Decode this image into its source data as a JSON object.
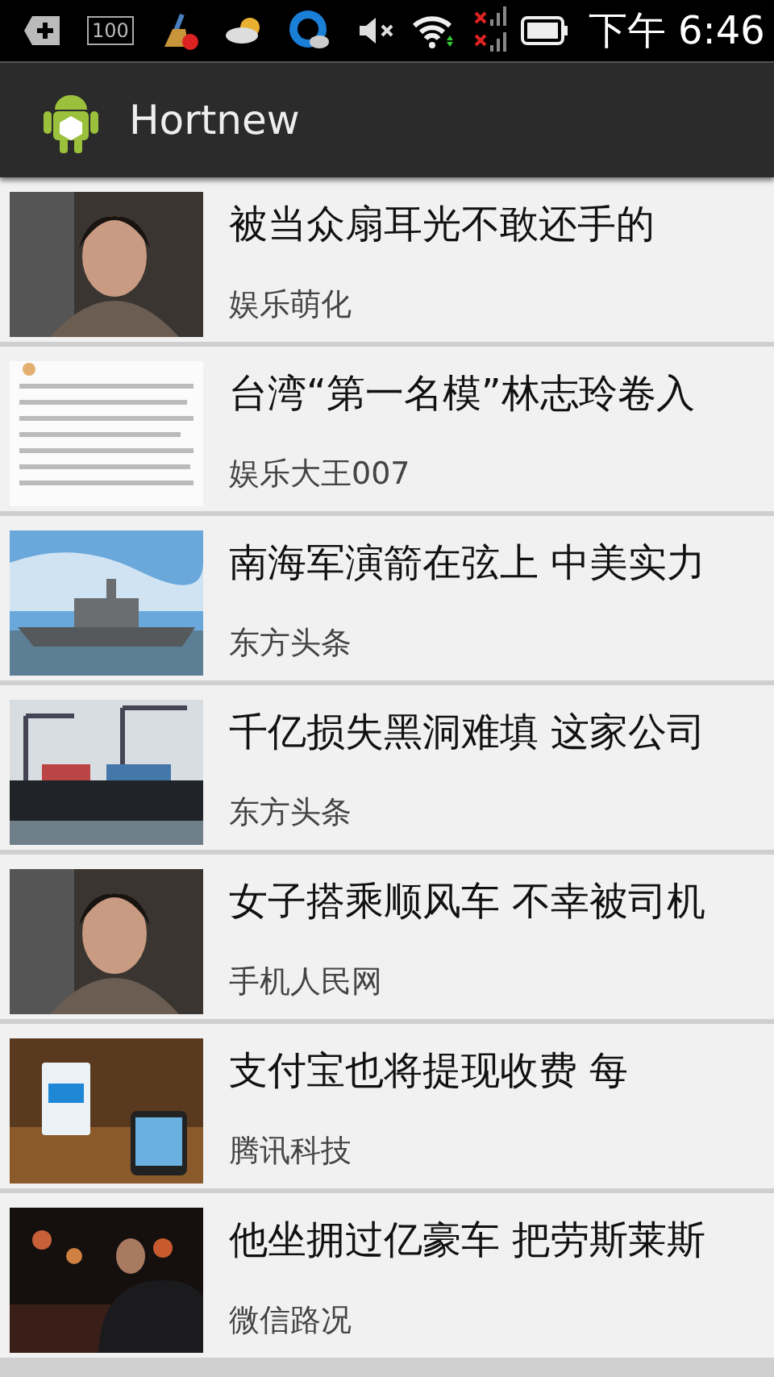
{
  "status_bar": {
    "storage_badge": "100",
    "time": "下午 6:46"
  },
  "action_bar": {
    "title": "Hortnew"
  },
  "news": [
    {
      "kind": "picture",
      "title": "被当众扇耳光不敢还手的",
      "source": "娱乐萌化"
    },
    {
      "kind": "picture",
      "title": "台湾“第一名模”林志玲卷入",
      "source": "娱乐大王007"
    },
    {
      "kind": "picture",
      "title": "南海军演箭在弦上 中美实力",
      "source": "东方头条"
    },
    {
      "kind": "picture",
      "title": "千亿损失黑洞难填 这家公司",
      "source": "东方头条"
    },
    {
      "kind": "picture",
      "title": "女子搭乘顺风车 不幸被司机",
      "source": "手机人民网"
    },
    {
      "kind": "picture",
      "title": "支付宝也将提现收费 每",
      "source": "腾讯科技"
    },
    {
      "kind": "picture",
      "title": "他坐拥过亿豪车 把劳斯莱斯",
      "source": "微信路况"
    }
  ]
}
